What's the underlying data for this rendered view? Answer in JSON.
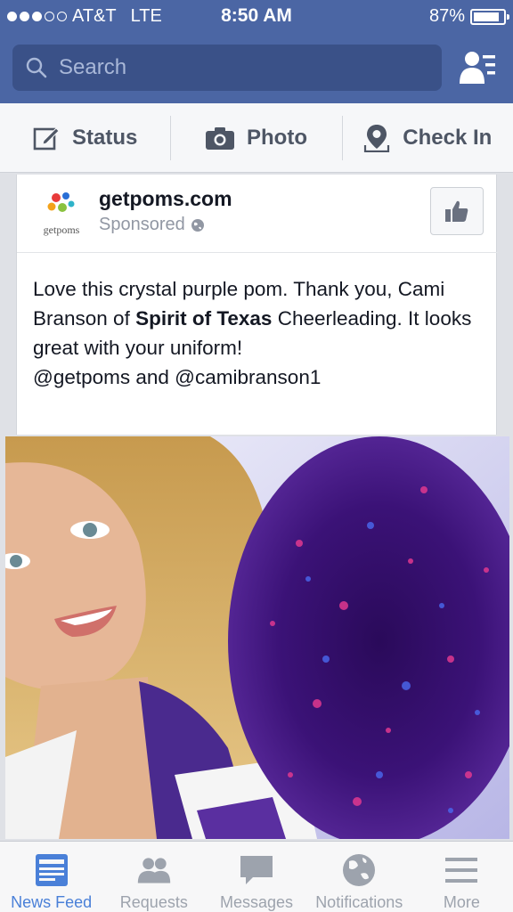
{
  "status_bar": {
    "carrier": "AT&T",
    "network": "LTE",
    "time": "8:50 AM",
    "battery_percent": "87%",
    "battery_level": 0.87,
    "signal_bars_filled": 3,
    "signal_bars_total": 5
  },
  "search": {
    "placeholder": "Search"
  },
  "composer": {
    "status_label": "Status",
    "photo_label": "Photo",
    "checkin_label": "Check In"
  },
  "post": {
    "page_name": "getpoms.com",
    "sponsored_label": "Sponsored",
    "logo_text": "getpoms",
    "text_part1": "Love this crystal purple pom. Thank you, Cami Branson of ",
    "text_bold": "Spirit of Texas",
    "text_part2": " Cheerleading. It looks great with your uniform!",
    "text_tags": "@getpoms and @camibranson1"
  },
  "tabs": [
    {
      "label": "News Feed",
      "icon": "news-feed-icon",
      "active": true
    },
    {
      "label": "Requests",
      "icon": "friend-requests-icon",
      "active": false
    },
    {
      "label": "Messages",
      "icon": "messages-icon",
      "active": false
    },
    {
      "label": "Notifications",
      "icon": "globe-icon",
      "active": false
    },
    {
      "label": "More",
      "icon": "menu-icon",
      "active": false
    }
  ],
  "colors": {
    "brand_blue": "#4b66a4",
    "search_bg": "#3a5188",
    "active_tab": "#4a80d8",
    "inactive_tab": "#9da3ad"
  }
}
